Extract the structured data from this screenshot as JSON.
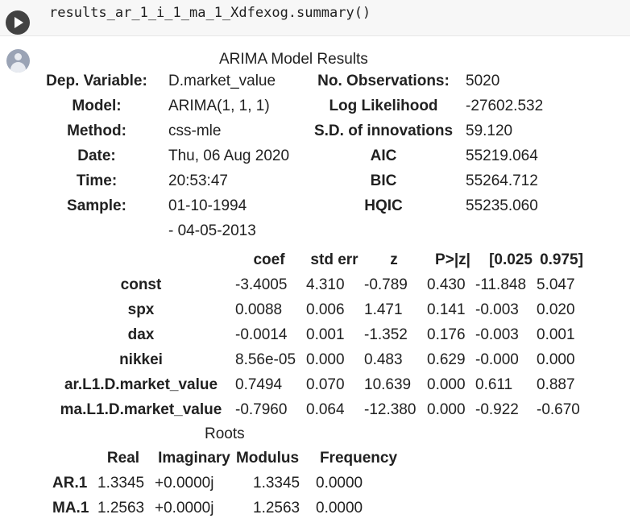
{
  "cell": {
    "code": "results_ar_1_i_1_ma_1_Xdfexog.summary()"
  },
  "summary": {
    "title": "ARIMA Model Results",
    "info_rows": [
      {
        "label1": "Dep. Variable:",
        "value1": "D.market_value",
        "label2": "No. Observations:",
        "value2": "5020"
      },
      {
        "label1": "Model:",
        "value1": "ARIMA(1, 1, 1)",
        "label2": "Log Likelihood",
        "value2": "-27602.532"
      },
      {
        "label1": "Method:",
        "value1": "css-mle",
        "label2": "S.D. of innovations",
        "value2": "59.120"
      },
      {
        "label1": "Date:",
        "value1": "Thu, 06 Aug 2020",
        "label2": "AIC",
        "value2": "55219.064"
      },
      {
        "label1": "Time:",
        "value1": "20:53:47",
        "label2": "BIC",
        "value2": "55264.712"
      },
      {
        "label1": "Sample:",
        "value1": "01-10-1994",
        "label2": "HQIC",
        "value2": "55235.060"
      },
      {
        "label1": "",
        "value1": "- 04-05-2013",
        "label2": "",
        "value2": ""
      }
    ],
    "coef_headers": [
      "",
      "coef",
      "std err",
      "z",
      "P>|z|",
      "[0.025",
      "0.975]"
    ],
    "coef_rows": [
      [
        "const",
        "-3.4005",
        "4.310",
        "-0.789",
        "0.430",
        "-11.848",
        "5.047"
      ],
      [
        "spx",
        "0.0088",
        "0.006",
        "1.471",
        "0.141",
        "-0.003",
        "0.020"
      ],
      [
        "dax",
        "-0.0014",
        "0.001",
        "-1.352",
        "0.176",
        "-0.003",
        "0.001"
      ],
      [
        "nikkei",
        "8.56e-05",
        "0.000",
        "0.483",
        "0.629",
        "-0.000",
        "0.000"
      ],
      [
        "ar.L1.D.market_value",
        "0.7494",
        "0.070",
        "10.639",
        "0.000",
        "0.611",
        "0.887"
      ],
      [
        "ma.L1.D.market_value",
        "-0.7960",
        "0.064",
        "-12.380",
        "0.000",
        "-0.922",
        "-0.670"
      ]
    ],
    "roots_title": "Roots",
    "roots_headers": [
      "",
      "Real",
      "Imaginary",
      "Modulus",
      "Frequency"
    ],
    "roots_rows": [
      [
        "AR.1",
        "1.3345",
        "+0.0000j",
        "1.3345",
        "0.0000"
      ],
      [
        "MA.1",
        "1.2563",
        "+0.0000j",
        "1.2563",
        "0.0000"
      ]
    ]
  }
}
